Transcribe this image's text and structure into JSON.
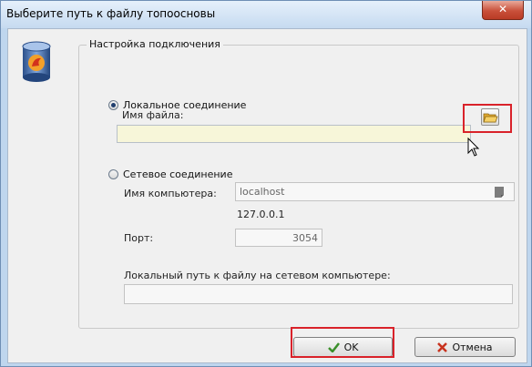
{
  "window": {
    "title": "Выберите путь к файлу топоосновы",
    "close_label": "✕"
  },
  "group": {
    "legend": "Настройка подключения"
  },
  "local": {
    "radio_label": "Локальное соединение",
    "selected": true,
    "file_label": "Имя файла:",
    "file_value": ""
  },
  "network": {
    "radio_label": "Сетевое соединение",
    "selected": false,
    "computer_label": "Имя компьютера:",
    "computer_value": "localhost",
    "ip_value": "127.0.0.1",
    "port_label": "Порт:",
    "port_value": "3054",
    "path_label": "Локальный путь к файлу на сетевом компьютере:",
    "path_value": ""
  },
  "buttons": {
    "ok_label": "OK",
    "cancel_label": "Отмена"
  },
  "icons": {
    "app": "database-icon",
    "browse": "folder-open-icon",
    "host_picker": "computer-icon",
    "ok": "checkmark-icon",
    "cancel": "cross-icon"
  },
  "colors": {
    "highlight": "#d9222a",
    "file_field_bg": "#f7f6d9"
  }
}
